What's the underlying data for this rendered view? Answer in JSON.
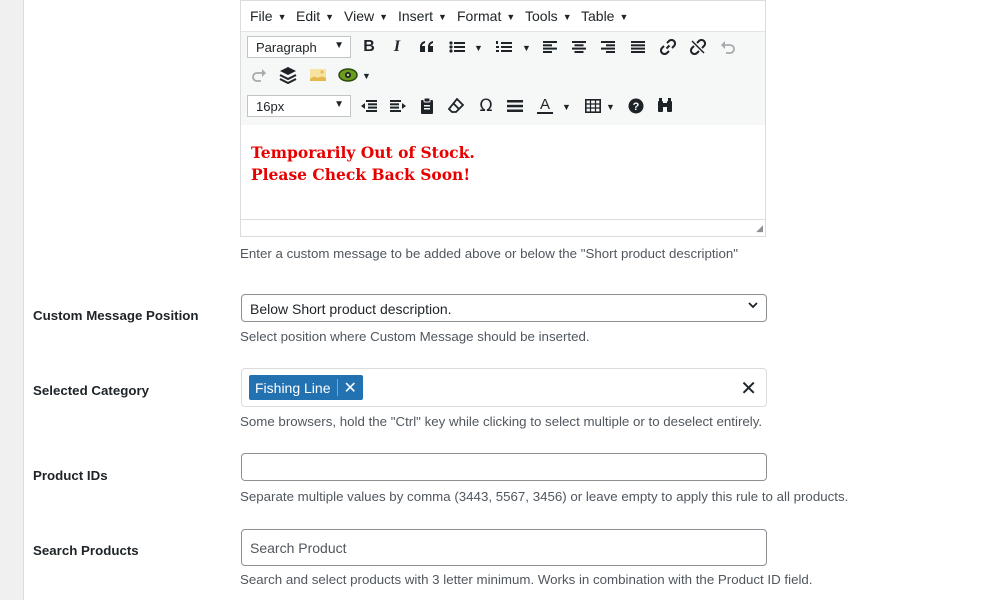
{
  "editor": {
    "menu": [
      "File",
      "Edit",
      "View",
      "Insert",
      "Format",
      "Tools",
      "Table"
    ],
    "format_select": "Paragraph",
    "font_size_select": "16px",
    "content_lines": [
      "Temporarily Out of Stock.",
      "Please Check Back Soon!"
    ],
    "content_color": "#e80000"
  },
  "fields": {
    "custom_message_help": "Enter a custom message to be added above or below the \"Short product description\"",
    "position": {
      "label": "Custom Message Position",
      "value": "Below Short product description.",
      "help": "Select position where Custom Message should be inserted."
    },
    "category": {
      "label": "Selected Category",
      "tag": "Fishing Line",
      "help": "Some browsers, hold the \"Ctrl\" key while clicking to select multiple or to deselect entirely."
    },
    "product_ids": {
      "label": "Product IDs",
      "value": "",
      "help": "Separate multiple values by comma (3443, 5567, 3456) or leave empty to apply this rule to all products."
    },
    "search": {
      "label": "Search Products",
      "placeholder": "Search Product",
      "help": "Search and select products with 3 letter minimum. Works in combination with the Product ID field."
    }
  },
  "colors": {
    "accent": "#2271b1",
    "gutter": "#f0f0f1"
  }
}
